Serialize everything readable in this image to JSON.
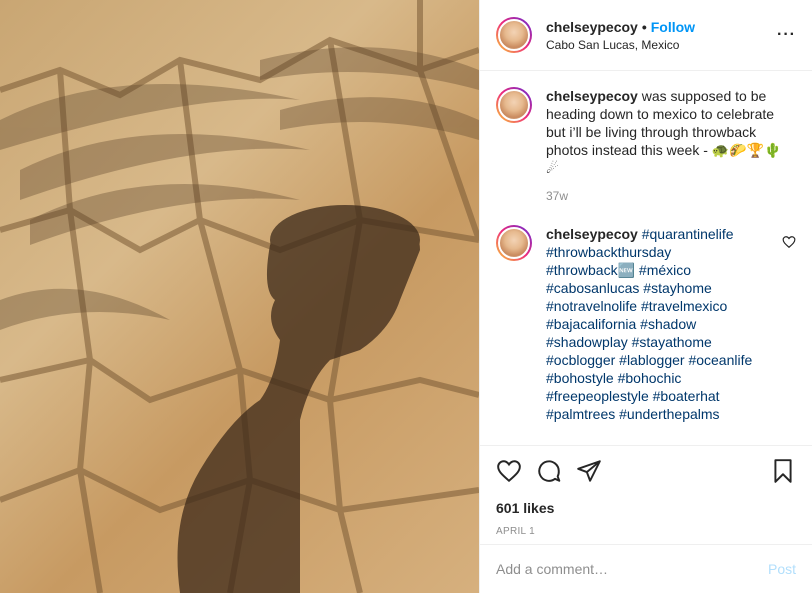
{
  "post": {
    "username": "chelseypecoy",
    "follow_label": "Follow",
    "dot": "•",
    "location": "Cabo San Lucas, Mexico",
    "more_label": "···"
  },
  "caption": {
    "username": "chelseypecoy",
    "text": "was supposed to be heading down to mexico to celebrate but i’ll be living through throwback photos instead this week - 🐢🌮🏆🌵☄",
    "age": "37w"
  },
  "comment": {
    "username": "chelseypecoy",
    "lines": [
      "#quarantinelife",
      "#throwbackthursday",
      "#throwback🆕 #méxico",
      "#cabosanlucas #stayhome",
      "#notravelnolife #travelmexico",
      "#bajacalifornia #shadow",
      "#shadowplay #stayathome",
      "#ocblogger #lablogger #oceanlife",
      "#bohostyle #bohochic",
      "#freepeoplestyle #boaterhat",
      "#palmtrees #underthepalms"
    ]
  },
  "stats": {
    "likes": "601 likes",
    "date": "APRIL 1"
  },
  "add_comment": {
    "placeholder": "Add a comment…",
    "post_label": "Post"
  },
  "icons": [
    "heart-icon",
    "comment-icon",
    "share-icon",
    "bookmark-icon",
    "more-icon"
  ]
}
